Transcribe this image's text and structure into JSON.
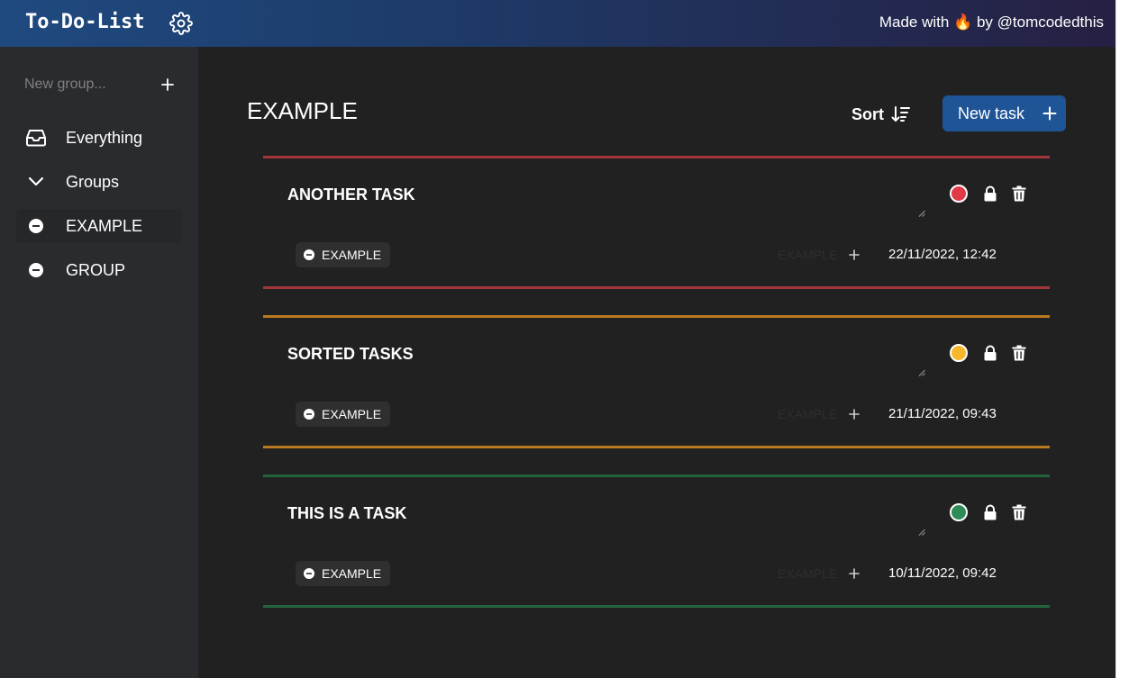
{
  "header": {
    "title": "To-Do-List",
    "credit_prefix": "Made with",
    "credit_emoji": "🔥",
    "credit_suffix": "by @tomcodedthis",
    "gradient_colors": [
      "#1f4a80",
      "#262043"
    ]
  },
  "sidebar": {
    "new_group_placeholder": "New group...",
    "items": [
      {
        "label": "Everything",
        "icon": "inbox-icon"
      },
      {
        "label": "Groups",
        "icon": "chevron-down-icon"
      },
      {
        "label": "EXAMPLE",
        "icon": "minus-circle-icon",
        "active": true
      },
      {
        "label": "GROUP",
        "icon": "minus-circle-icon"
      }
    ]
  },
  "main": {
    "title": "EXAMPLE",
    "sort_label": "Sort",
    "new_task_label": "New task"
  },
  "tasks": [
    {
      "title": "ANOTHER TASK",
      "group": "EXAMPLE",
      "ghost": "EXAMPLE",
      "date": "22/11/2022, 12:42",
      "priority_color": "#e03a48",
      "bar_color": "#a3363b"
    },
    {
      "title": "SORTED TASKS",
      "group": "EXAMPLE",
      "ghost": "EXAMPLE",
      "date": "21/11/2022, 09:43",
      "priority_color": "#f5b82a",
      "bar_color": "#b8791f"
    },
    {
      "title": "THIS IS A TASK",
      "group": "EXAMPLE",
      "ghost": "EXAMPLE",
      "date": "10/11/2022, 09:42",
      "priority_color": "#2e8b57",
      "bar_color": "#23633b"
    }
  ],
  "colors": {
    "accent": "#1f5497",
    "background": "#212121",
    "sidebar": "#2a2b2e"
  }
}
